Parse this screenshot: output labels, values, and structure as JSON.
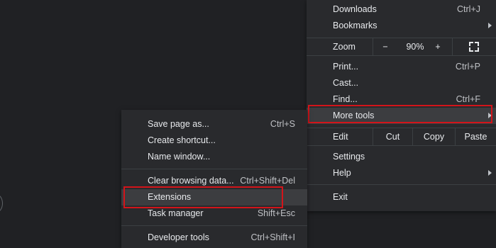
{
  "main_menu": {
    "downloads": {
      "label": "Downloads",
      "shortcut": "Ctrl+J"
    },
    "bookmarks": {
      "label": "Bookmarks"
    },
    "zoom": {
      "label": "Zoom",
      "minus": "−",
      "value": "90%",
      "plus": "+"
    },
    "print": {
      "label": "Print...",
      "shortcut": "Ctrl+P"
    },
    "cast": {
      "label": "Cast..."
    },
    "find": {
      "label": "Find...",
      "shortcut": "Ctrl+F"
    },
    "more_tools": {
      "label": "More tools"
    },
    "edit": {
      "label": "Edit",
      "cut": "Cut",
      "copy": "Copy",
      "paste": "Paste"
    },
    "settings": {
      "label": "Settings"
    },
    "help": {
      "label": "Help"
    },
    "exit": {
      "label": "Exit"
    }
  },
  "submenu": {
    "save_page": {
      "label": "Save page as...",
      "shortcut": "Ctrl+S"
    },
    "create_shortcut": {
      "label": "Create shortcut..."
    },
    "name_window": {
      "label": "Name window..."
    },
    "clear_browsing": {
      "label": "Clear browsing data...",
      "shortcut": "Ctrl+Shift+Del"
    },
    "extensions": {
      "label": "Extensions"
    },
    "task_manager": {
      "label": "Task manager",
      "shortcut": "Shift+Esc"
    },
    "developer_tools": {
      "label": "Developer tools",
      "shortcut": "Ctrl+Shift+I"
    }
  },
  "highlight_color": "#d3141a",
  "icons": {
    "submenu_arrow": "chevron-right-icon",
    "fullscreen": "fullscreen-icon"
  }
}
